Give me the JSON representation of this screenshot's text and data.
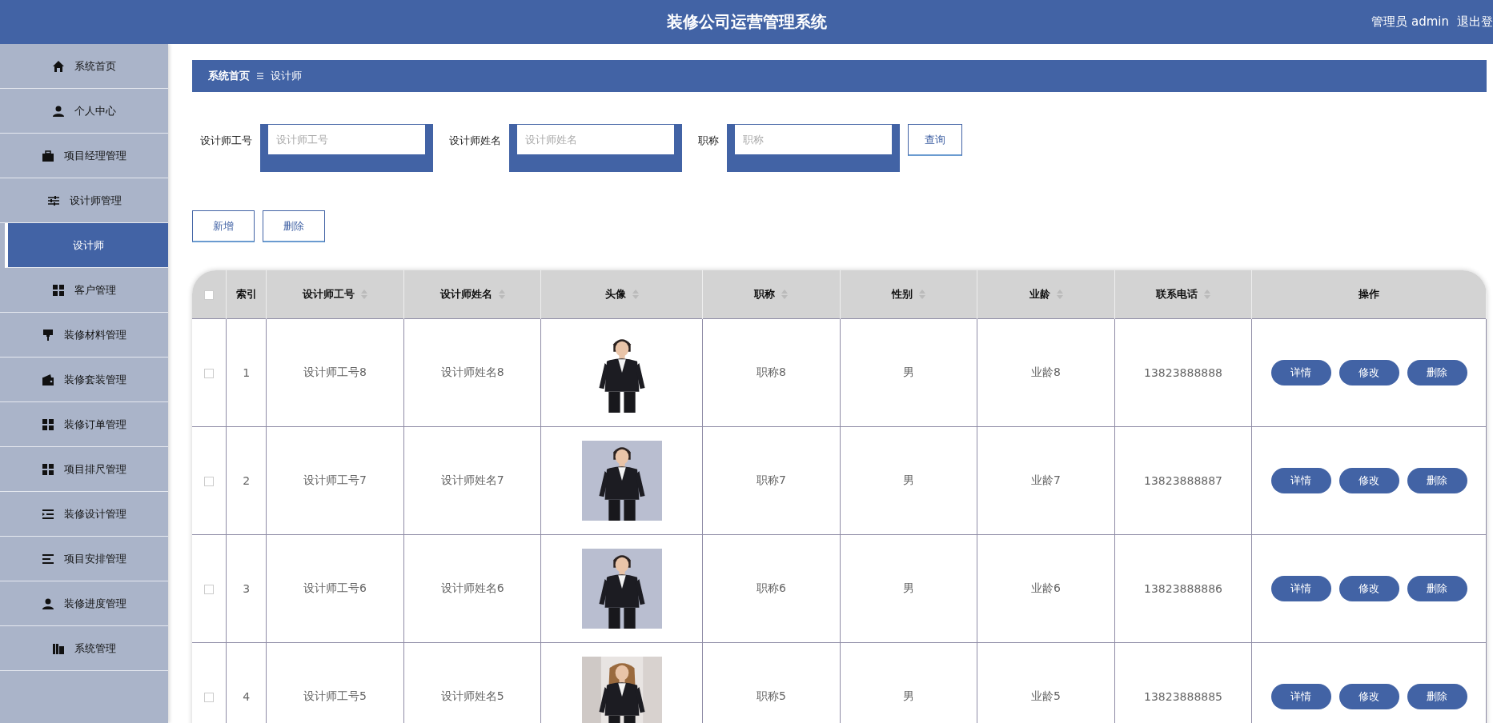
{
  "header": {
    "title": "装修公司运营管理系统",
    "user": "管理员 admin",
    "logout": "退出登"
  },
  "sidebar": {
    "items": [
      {
        "label": "系统首页",
        "selected": false
      },
      {
        "label": "个人中心",
        "selected": false
      },
      {
        "label": "项目经理管理",
        "selected": false
      },
      {
        "label": "设计师管理",
        "selected": false,
        "expanded": true,
        "children": [
          {
            "label": "设计师",
            "selected": true
          }
        ]
      },
      {
        "label": "客户管理",
        "selected": false
      },
      {
        "label": "装修材料管理",
        "selected": false
      },
      {
        "label": "装修套装管理",
        "selected": false
      },
      {
        "label": "装修订单管理",
        "selected": false
      },
      {
        "label": "项目排尺管理",
        "selected": false
      },
      {
        "label": "装修设计管理",
        "selected": false
      },
      {
        "label": "项目安排管理",
        "selected": false
      },
      {
        "label": "装修进度管理",
        "selected": false
      },
      {
        "label": "系统管理",
        "selected": false
      }
    ]
  },
  "breadcrumb": [
    "系统首页",
    "设计师"
  ],
  "search": {
    "fields": [
      {
        "label": "设计师工号",
        "placeholder": "设计师工号"
      },
      {
        "label": "设计师姓名",
        "placeholder": "设计师姓名"
      },
      {
        "label": "职称",
        "placeholder": "职称"
      }
    ],
    "button": "查询"
  },
  "actions": [
    "新增",
    "删除"
  ],
  "table": {
    "select_all": {
      "checked": false
    },
    "columns": [
      {
        "label": "索引",
        "sortable": false
      },
      {
        "label": "设计师工号",
        "sortable": true
      },
      {
        "label": "设计师姓名",
        "sortable": true
      },
      {
        "label": "头像",
        "sortable": true
      },
      {
        "label": "职称",
        "sortable": true
      },
      {
        "label": "性别",
        "sortable": true
      },
      {
        "label": "业龄",
        "sortable": true
      },
      {
        "label": "联系电话",
        "sortable": true
      },
      {
        "label": "操作",
        "sortable": false
      }
    ],
    "rows": [
      {
        "checked": false,
        "index": "1",
        "id": "设计师工号8",
        "name": "设计师姓名8",
        "photo": {
          "kind": "picture"
        },
        "title": "职称8",
        "gender": "男",
        "years": "业龄8",
        "phone": "13823888888",
        "buttons": [
          "详情",
          "修改",
          "删除"
        ]
      },
      {
        "checked": false,
        "index": "2",
        "id": "设计师工号7",
        "name": "设计师姓名7",
        "photo": {
          "kind": "picture"
        },
        "title": "职称7",
        "gender": "男",
        "years": "业龄7",
        "phone": "13823888887",
        "buttons": [
          "详情",
          "修改",
          "删除"
        ]
      },
      {
        "checked": false,
        "index": "3",
        "id": "设计师工号6",
        "name": "设计师姓名6",
        "photo": {
          "kind": "picture"
        },
        "title": "职称6",
        "gender": "男",
        "years": "业龄6",
        "phone": "13823888886",
        "buttons": [
          "详情",
          "修改",
          "删除"
        ]
      },
      {
        "checked": false,
        "index": "4",
        "id": "设计师工号5",
        "name": "设计师姓名5",
        "photo": {
          "kind": "picture"
        },
        "title": "职称5",
        "gender": "男",
        "years": "业龄5",
        "phone": "13823888885",
        "buttons": [
          "详情",
          "修改",
          "删除"
        ]
      }
    ]
  }
}
